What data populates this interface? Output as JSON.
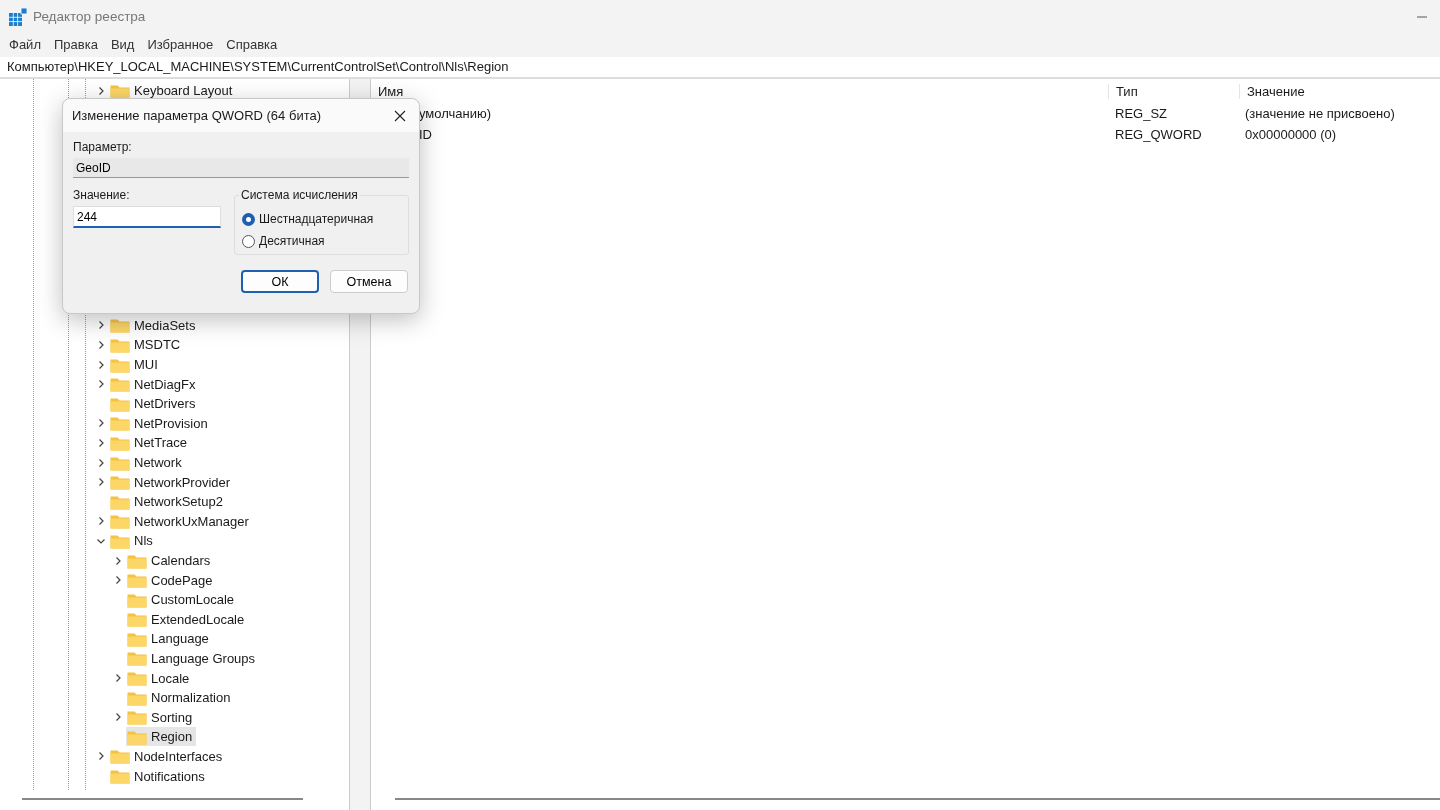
{
  "window": {
    "title": "Редактор реестра"
  },
  "menu": [
    "Файл",
    "Правка",
    "Вид",
    "Избранное",
    "Справка"
  ],
  "address": "Компьютер\\HKEY_LOCAL_MACHINE\\SYSTEM\\CurrentControlSet\\Control\\Nls\\Region",
  "tree": {
    "groups": [
      [
        {
          "label": "Keyboard Layout",
          "expandable": true,
          "expanded": false,
          "selected": false
        }
      ],
      [
        {
          "label": "MediaSets",
          "expandable": true,
          "expanded": false,
          "selected": false
        },
        {
          "label": "MSDTC",
          "expandable": true,
          "expanded": false,
          "selected": false
        },
        {
          "label": "MUI",
          "expandable": true,
          "expanded": false,
          "selected": false
        },
        {
          "label": "NetDiagFx",
          "expandable": true,
          "expanded": false,
          "selected": false
        },
        {
          "label": "NetDrivers",
          "expandable": false,
          "expanded": false,
          "selected": false
        },
        {
          "label": "NetProvision",
          "expandable": true,
          "expanded": false,
          "selected": false
        },
        {
          "label": "NetTrace",
          "expandable": true,
          "expanded": false,
          "selected": false
        },
        {
          "label": "Network",
          "expandable": true,
          "expanded": false,
          "selected": false
        },
        {
          "label": "NetworkProvider",
          "expandable": true,
          "expanded": false,
          "selected": false
        },
        {
          "label": "NetworkSetup2",
          "expandable": false,
          "expanded": false,
          "selected": false
        },
        {
          "label": "NetworkUxManager",
          "expandable": true,
          "expanded": false,
          "selected": false
        },
        {
          "label": "Nls",
          "expandable": true,
          "expanded": true,
          "selected": false,
          "children": [
            {
              "label": "Calendars",
              "expandable": true,
              "expanded": false,
              "selected": false
            },
            {
              "label": "CodePage",
              "expandable": true,
              "expanded": false,
              "selected": false
            },
            {
              "label": "CustomLocale",
              "expandable": false,
              "expanded": false,
              "selected": false
            },
            {
              "label": "ExtendedLocale",
              "expandable": false,
              "expanded": false,
              "selected": false
            },
            {
              "label": "Language",
              "expandable": false,
              "expanded": false,
              "selected": false
            },
            {
              "label": "Language Groups",
              "expandable": false,
              "expanded": false,
              "selected": false
            },
            {
              "label": "Locale",
              "expandable": true,
              "expanded": false,
              "selected": false
            },
            {
              "label": "Normalization",
              "expandable": false,
              "expanded": false,
              "selected": false
            },
            {
              "label": "Sorting",
              "expandable": true,
              "expanded": false,
              "selected": false
            },
            {
              "label": "Region",
              "expandable": false,
              "expanded": false,
              "selected": true
            }
          ]
        },
        {
          "label": "NodeInterfaces",
          "expandable": true,
          "expanded": false,
          "selected": false
        },
        {
          "label": "Notifications",
          "expandable": false,
          "expanded": false,
          "selected": false
        }
      ]
    ]
  },
  "values": {
    "columns": [
      "Имя",
      "Тип",
      "Значение"
    ],
    "rows": [
      {
        "name": "умолчанию)",
        "type": "REG_SZ",
        "value": "(значение не присвоено)"
      },
      {
        "name": "ID",
        "type": "REG_QWORD",
        "value": "0x00000000 (0)"
      }
    ]
  },
  "dialog": {
    "title": "Изменение параметра QWORD (64 бита)",
    "param_label": "Параметр:",
    "param_value": "GeoID",
    "value_label": "Значение:",
    "value": "244",
    "base_group": {
      "title": "Система исчисления",
      "options": [
        {
          "label": "Шестнадцатеричная",
          "selected": true
        },
        {
          "label": "Десятичная",
          "selected": false
        }
      ]
    },
    "buttons": [
      {
        "label": "ОК",
        "default": true
      },
      {
        "label": "Отмена",
        "default": false
      }
    ]
  }
}
